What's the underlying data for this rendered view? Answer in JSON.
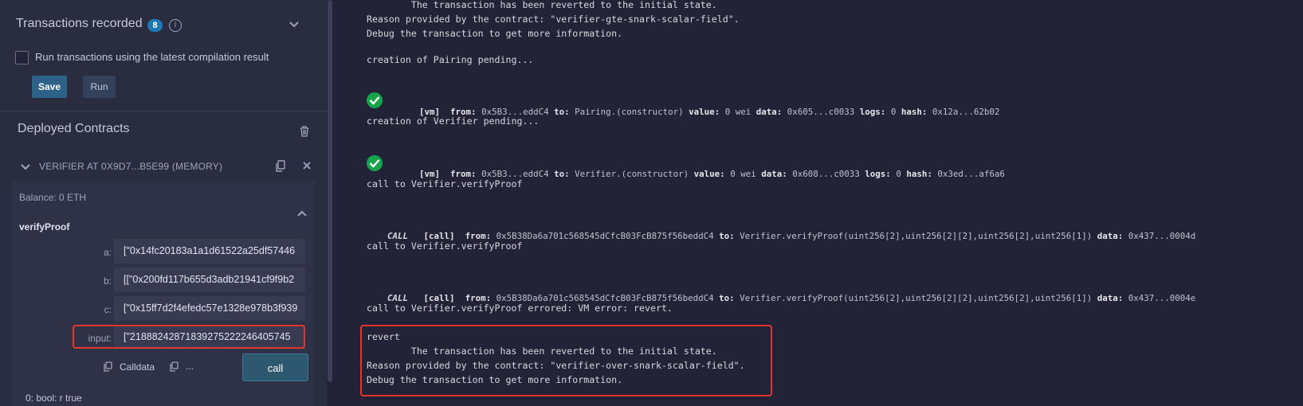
{
  "left": {
    "transactions": {
      "title": "Transactions recorded",
      "count": "8",
      "info_icon": "i",
      "checkbox_label": "Run transactions using the latest compilation result",
      "save_label": "Save",
      "run_label": "Run"
    },
    "deployed": {
      "title": "Deployed Contracts",
      "contract_title": "VERIFIER AT 0X9D7...B5E99 (MEMORY)",
      "balance": "Balance: 0 ETH",
      "function_name": "verifyProof",
      "params": [
        {
          "label": "a:",
          "value": "[\"0x14fc20183a1a1d61522a25df57446"
        },
        {
          "label": "b:",
          "value": "[[\"0x200fd117b655d3adb21941cf9f9b2"
        },
        {
          "label": "c:",
          "value": "[\"0x15ff7d2f4efedc57e1328e978b3f939"
        },
        {
          "label": "input:",
          "value": "[\"21888242871839275222246405745"
        }
      ],
      "calldata_label": "Calldata",
      "parameters_label": "...",
      "call_label": "call",
      "result": "0: bool: r true"
    }
  },
  "terminal": {
    "lines": [
      "        The transaction has been reverted to the initial state.",
      "Reason provided by the contract: \"verifier-gte-snark-scalar-field\".",
      "Debug the transaction to get more information.",
      "creation of Pairing pending...",
      "creation of Verifier pending...",
      "call to Verifier.verifyProof",
      "call to Verifier.verifyProof",
      "call to Verifier.verifyProof errored: VM error: revert.",
      "revert",
      "        The transaction has been reverted to the initial state.",
      "Reason provided by the contract: \"verifier-over-snark-scalar-field\".",
      "Debug the transaction to get more information."
    ],
    "tx1": {
      "tag": "[vm]",
      "from_label": "from:",
      "from": "0x5B3...eddC4",
      "to_label": "to:",
      "to": "Pairing.(constructor)",
      "value_label": "value:",
      "value": "0 wei",
      "data_label": "data:",
      "data": "0x605...c0033",
      "logs_label": "logs:",
      "logs": "0",
      "hash_label": "hash:",
      "hash": "0x12a...62b02"
    },
    "tx2": {
      "tag": "[vm]",
      "from_label": "from:",
      "from": "0x5B3...eddC4",
      "to_label": "to:",
      "to": "Verifier.(constructor)",
      "value_label": "value:",
      "value": "0 wei",
      "data_label": "data:",
      "data": "0x608...c0033",
      "logs_label": "logs:",
      "logs": "0",
      "hash_label": "hash:",
      "hash": "0x3ed...af6a6"
    },
    "call1": {
      "kind": "CALL",
      "tag": "[call]",
      "from_label": "from:",
      "from": "0x5B38Da6a701c568545dCfcB03FcB875f56beddC4",
      "to_label": "to:",
      "to": "Verifier.verifyProof(uint256[2],uint256[2][2],uint256[2],uint256[1])",
      "data_label": "data:",
      "data": "0x437...0004d"
    },
    "call2": {
      "kind": "CALL",
      "tag": "[call]",
      "from_label": "from:",
      "from": "0x5B38Da6a701c568545dCfcB03FcB875f56beddC4",
      "to_label": "to:",
      "to": "Verifier.verifyProof(uint256[2],uint256[2][2],uint256[2],uint256[1])",
      "data_label": "data:",
      "data": "0x437...0004e"
    }
  },
  "colors": {
    "accent_blue": "#1e78b3",
    "success_green": "#17a34a",
    "highlight_red": "#e2362d"
  }
}
